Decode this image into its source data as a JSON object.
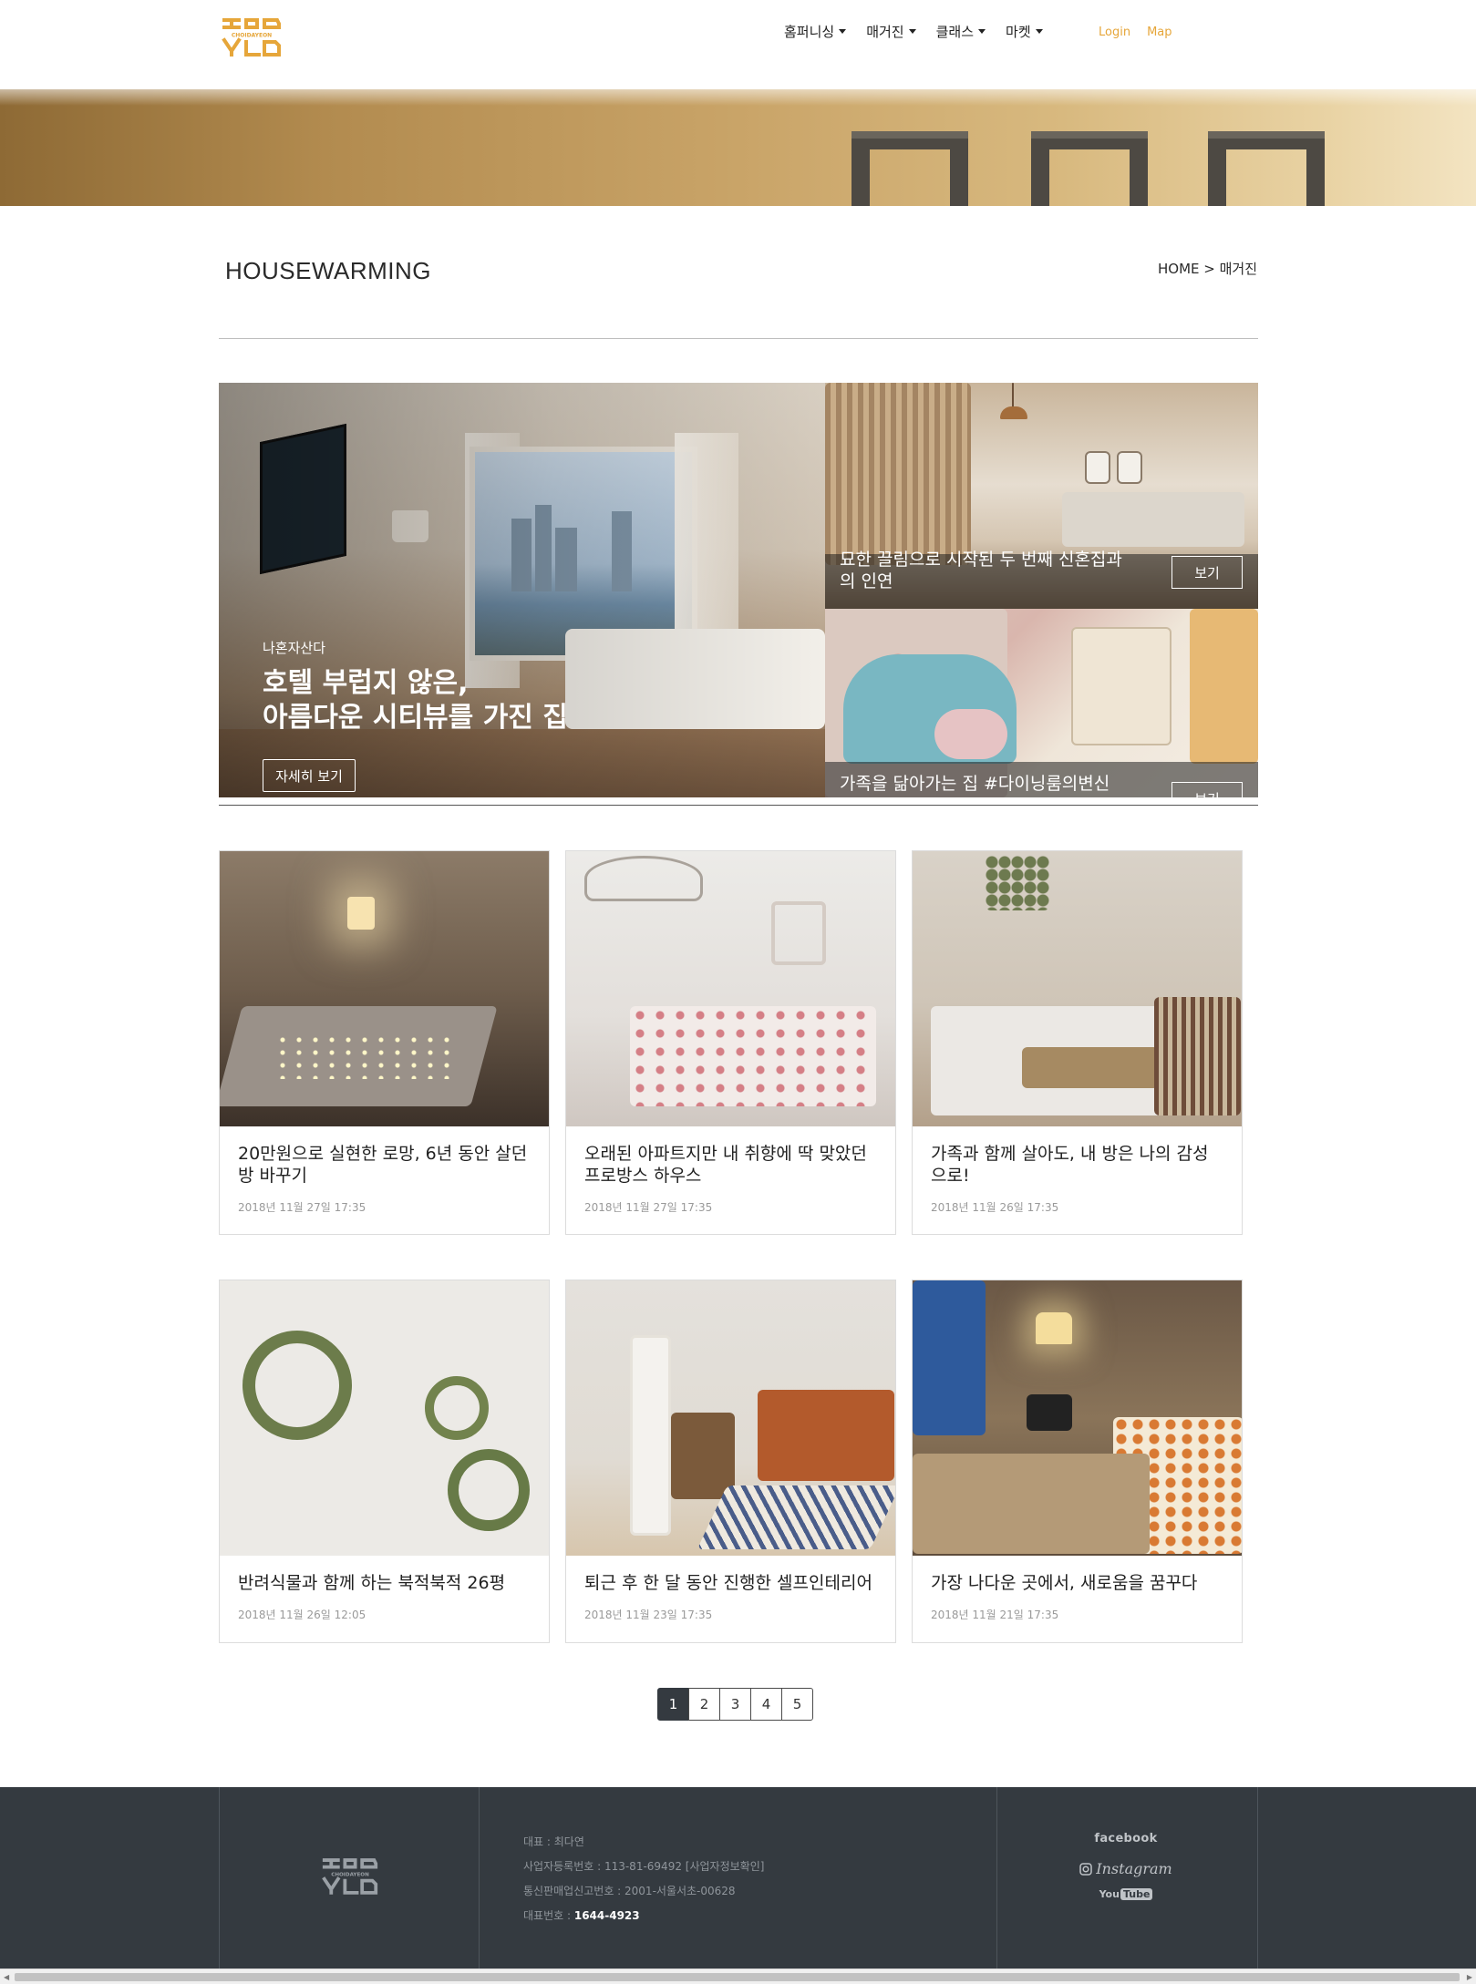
{
  "brand": {
    "logo_text": "CHOIDAYEON",
    "accent": "#e6a63a"
  },
  "nav": {
    "items": [
      {
        "label": "홈퍼니싱"
      },
      {
        "label": "매거진"
      },
      {
        "label": "클래스"
      },
      {
        "label": "마켓"
      }
    ],
    "login": "Login",
    "map": "Map"
  },
  "page": {
    "title": "HOUSEWARMING",
    "breadcrumb": "HOME > 매거진"
  },
  "featured": {
    "main": {
      "category": "나혼자산다",
      "title_line1": "호텔 부럽지 않은,",
      "title_line2": "아름다운 시티뷰를 가진 집",
      "button": "자세히 보기"
    },
    "side": [
      {
        "title_line1": "묘한 끌림으로 시작된 두 번째 신혼집과",
        "title_line2": "의 인연",
        "button": "보기"
      },
      {
        "title_line1": "가족을 닮아가는 집 #다이닝룸의변신",
        "button": "보기"
      }
    ]
  },
  "cards": [
    {
      "title": "20만원으로 실현한 로망, 6년 동안 살던 방 바꾸기",
      "date": "2018년 11월 27일 17:35"
    },
    {
      "title": "오래된 아파트지만 내 취향에 딱 맞았던 프로방스 하우스",
      "date": "2018년 11월 27일 17:35"
    },
    {
      "title": "가족과 함께 살아도, 내 방은 나의 감성으로!",
      "date": "2018년 11월 26일 17:35"
    },
    {
      "title": "반려식물과 함께 하는 북적북적 26평",
      "date": "2018년 11월 26일 12:05"
    },
    {
      "title": "퇴근 후 한 달 동안 진행한 셀프인테리어",
      "date": "2018년 11월 23일 17:35"
    },
    {
      "title": "가장 나다운 곳에서, 새로움을 꿈꾸다",
      "date": "2018년 11월 21일 17:35"
    }
  ],
  "pagination": {
    "pages": [
      "1",
      "2",
      "3",
      "4",
      "5"
    ],
    "current": "1"
  },
  "footer": {
    "ceo": "대표 : 최다연",
    "business_no": "사업자등록번호 : 113-81-69492 [사업자정보확인]",
    "ecommerce_no": "통신판매업신고번호 : 2001-서울서초-00628",
    "phone_label": "대표번호 : ",
    "phone": "1644-4923",
    "social": {
      "facebook": "facebook",
      "instagram": "Instagram",
      "youtube_you": "You",
      "youtube_tube": "Tube"
    }
  }
}
